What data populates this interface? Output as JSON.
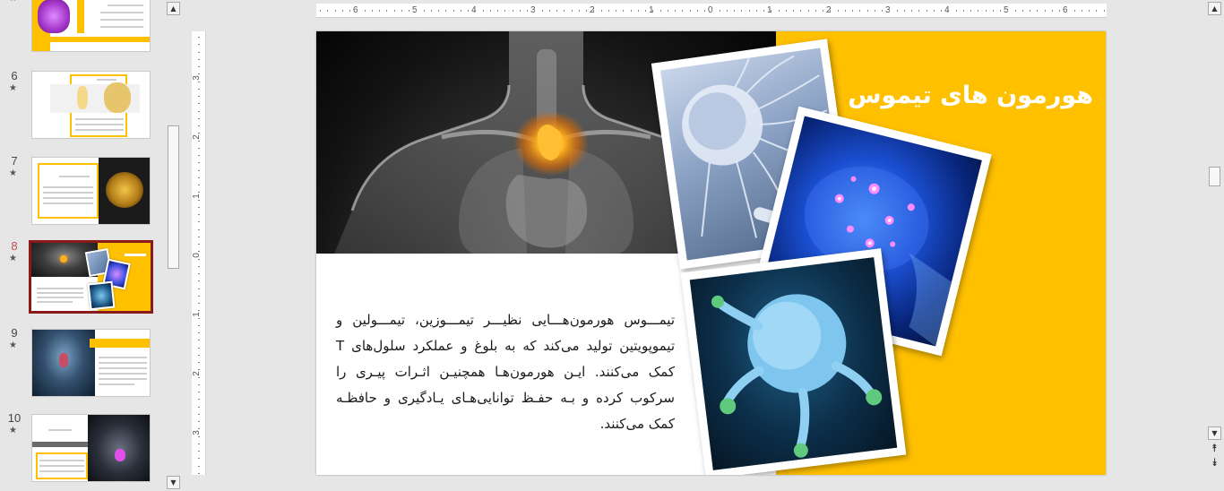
{
  "thumbnails": [
    {
      "number": "",
      "star": "★",
      "active": false
    },
    {
      "number": "6",
      "star": "★",
      "active": false
    },
    {
      "number": "7",
      "star": "★",
      "active": false
    },
    {
      "number": "8",
      "star": "★",
      "active": true
    },
    {
      "number": "9",
      "star": "★",
      "active": false
    },
    {
      "number": "10",
      "star": "★",
      "active": false
    }
  ],
  "ruler": {
    "h_labels": [
      "6",
      "5",
      "4",
      "3",
      "2",
      "1",
      "0",
      "1",
      "2",
      "3",
      "4",
      "5",
      "6"
    ],
    "v_labels": [
      "3",
      "2",
      "1",
      "0",
      "1",
      "2",
      "3"
    ]
  },
  "slide": {
    "title": "هورمون های تیموس",
    "body": "تیمـــوس هورمون‌هـــایی نظیـــر تیمـــوزین، تیمـــولین و تیموپویتین تولید می‌کند که به بلوغ و عملکرد سلول‌های T کمک می‌کنند. ایـن هورمون‌هـا همچنیـن اثـرات پیـری را سرکوب کرده و بـه حفـظ توانایی‌هـای یـادگیری و حافظـه کمک می‌کنند."
  },
  "colors": {
    "accent": "#ffc000",
    "active_thumb_border": "#8b1a1a",
    "active_number": "#c0504d"
  },
  "icons": {
    "scroll_up": "▲",
    "scroll_down": "▼",
    "prev_slide": "⯭",
    "next_slide": "⯯"
  }
}
